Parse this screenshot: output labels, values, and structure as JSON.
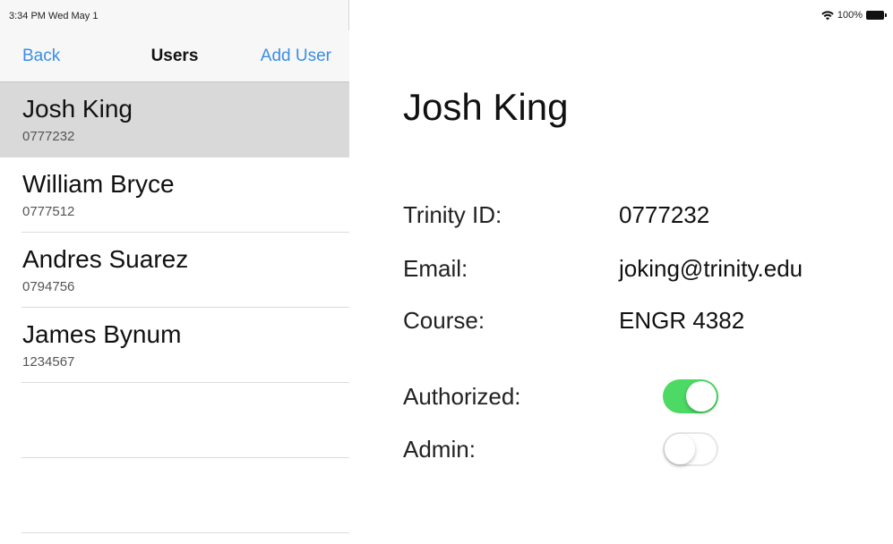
{
  "status_bar": {
    "time": "3:34 PM   Wed May 1",
    "battery": "100%"
  },
  "navbar": {
    "back_label": "Back",
    "title": "Users",
    "add_label": "Add User"
  },
  "users": [
    {
      "name": "Josh King",
      "id": "0777232"
    },
    {
      "name": "William Bryce",
      "id": "0777512"
    },
    {
      "name": "Andres Suarez",
      "id": "0794756"
    },
    {
      "name": "James Bynum",
      "id": "1234567"
    }
  ],
  "detail": {
    "name": "Josh King",
    "id_label": "Trinity ID:",
    "id_value": "0777232",
    "email_label": "Email:",
    "email_value": "joking@trinity.edu",
    "course_label": "Course:",
    "course_value": "ENGR 4382",
    "authorized_label": "Authorized:",
    "authorized": true,
    "admin_label": "Admin:",
    "admin": false
  },
  "colors": {
    "accent": "#3a8ee6",
    "toggle_on": "#4cd964",
    "selected_row": "#d9d9d9"
  }
}
